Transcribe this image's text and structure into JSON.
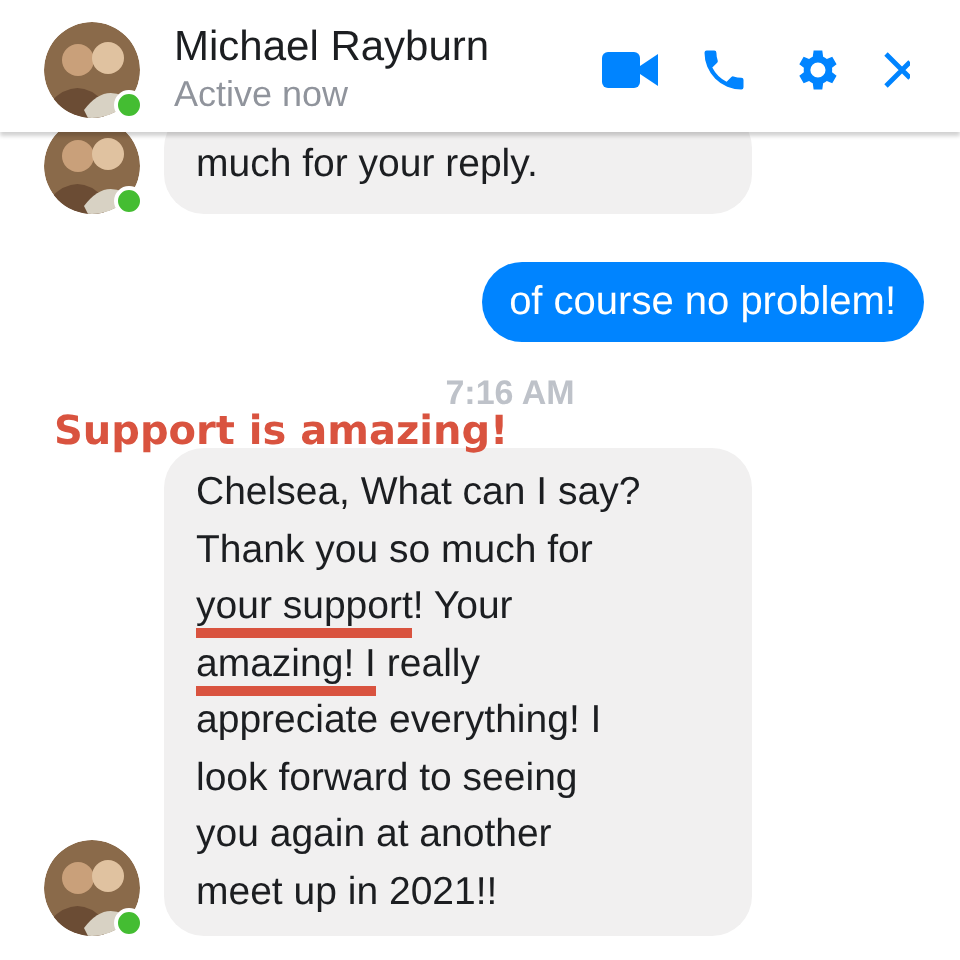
{
  "header": {
    "name": "Michael Rayburn",
    "status": "Active now",
    "online": true
  },
  "messages": [
    {
      "kind": "received",
      "online": true,
      "segments": [
        {
          "text": "much for your reply.",
          "underlined": false
        }
      ]
    },
    {
      "kind": "sent",
      "segments": [
        {
          "text": "of course no problem!",
          "underlined": false
        }
      ]
    },
    {
      "kind": "time",
      "text": "7:16 AM"
    },
    {
      "kind": "received",
      "online": true,
      "segments": [
        {
          "text": "Chelsea, What can I say?\nThank you so much for\n",
          "underlined": false
        },
        {
          "text": "your support",
          "underlined": true
        },
        {
          "text": "! Your\n",
          "underlined": false
        },
        {
          "text": "amazing! I",
          "underlined": true
        },
        {
          "text": " really\nappreciate everything! I\nlook forward to seeing\nyou again at another\nmeet up in 2021!!",
          "underlined": false
        }
      ]
    }
  ],
  "annotation": {
    "text": "Support is amazing!"
  }
}
